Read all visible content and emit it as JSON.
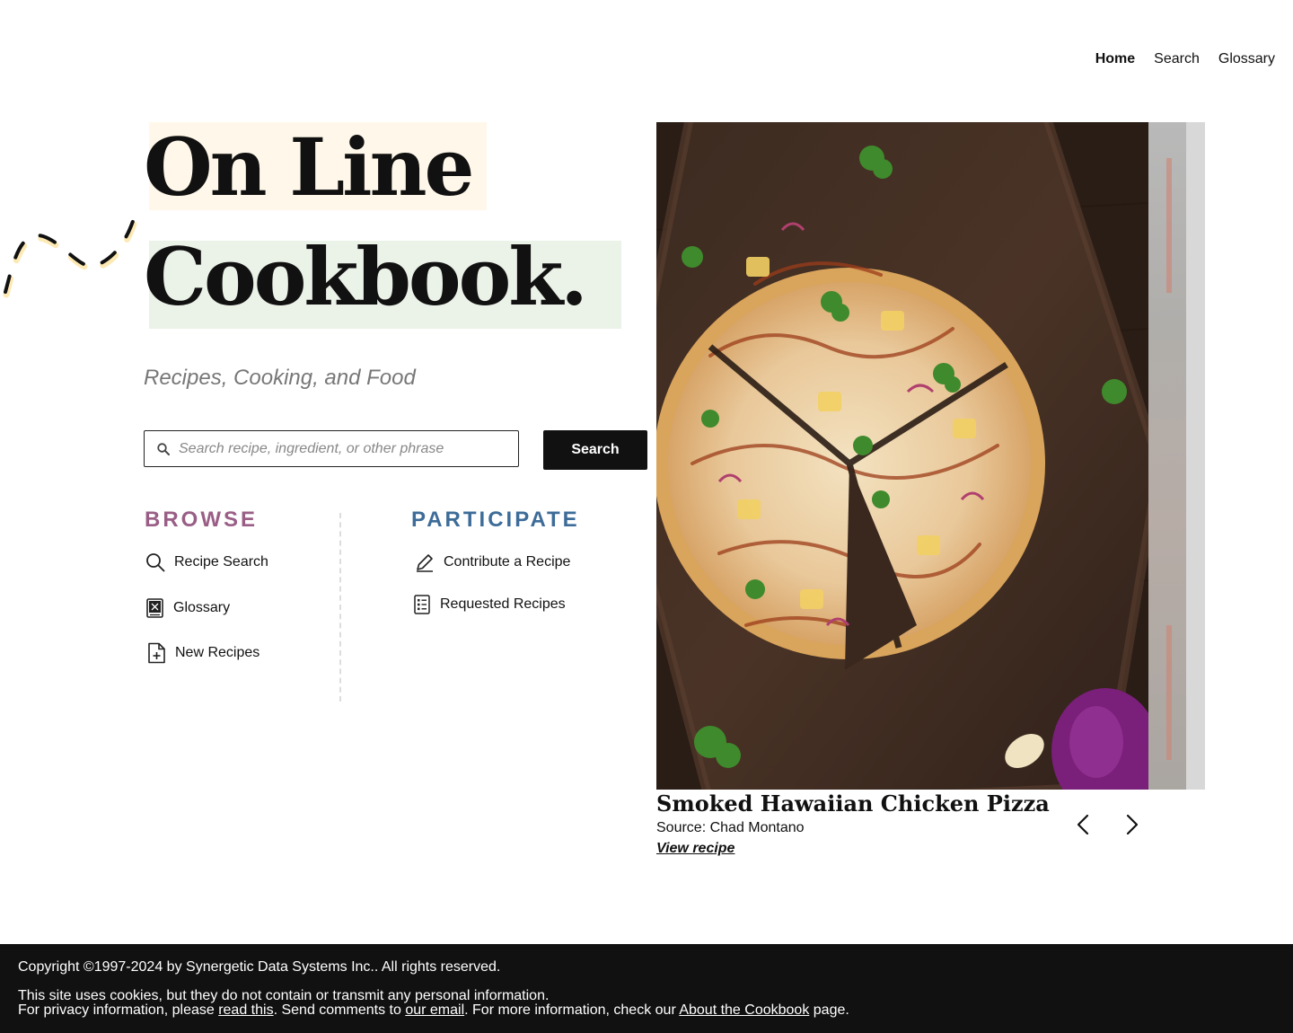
{
  "nav": {
    "items": [
      {
        "label": "Home",
        "active": true
      },
      {
        "label": "Search",
        "active": false
      },
      {
        "label": "Glossary",
        "active": false
      }
    ]
  },
  "hero": {
    "title_line1": "On Line",
    "title_line2": "Cookbook.",
    "tagline": "Recipes, Cooking, and Food"
  },
  "search": {
    "placeholder": "Search recipe, ingredient, or other phrase",
    "value": "",
    "button_label": "Search",
    "icon": "search-icon"
  },
  "browse": {
    "heading": "BROWSE",
    "color": "#9a5e86",
    "items": [
      {
        "label": "Recipe Search",
        "icon": "magnifier-icon"
      },
      {
        "label": "Glossary",
        "icon": "glossary-book-icon"
      },
      {
        "label": "New Recipes",
        "icon": "file-plus-icon"
      }
    ]
  },
  "participate": {
    "heading": "PARTICIPATE",
    "color": "#3d6c98",
    "items": [
      {
        "label": "Contribute a Recipe",
        "icon": "pencil-icon"
      },
      {
        "label": "Requested Recipes",
        "icon": "list-document-icon"
      }
    ]
  },
  "carousel": {
    "title": "Smoked Hawaiian Chicken Pizza",
    "source": "Source: Chad Montano",
    "link_label": "View recipe",
    "prev_icon": "chevron-left-icon",
    "next_icon": "chevron-right-icon"
  },
  "footer": {
    "copyright": "Copyright ©1997-2024 by Synergetic Data Systems Inc.. All rights reserved.",
    "cookies": "This site uses cookies, but they do not contain or transmit any personal information.",
    "privacy_prefix": "For privacy information, please ",
    "privacy_link": "read this",
    "comments_prefix": ". Send comments to ",
    "email_link": "our email",
    "info_prefix": ". For more information, check our ",
    "about_link": "About the Cookbook",
    "info_suffix": " page."
  },
  "colors": {
    "title_highlight_1": "#fff8ea",
    "title_highlight_2": "#ebf2e8",
    "nav_active_highlight": "#fde9b4",
    "footer_bg": "#111111"
  }
}
